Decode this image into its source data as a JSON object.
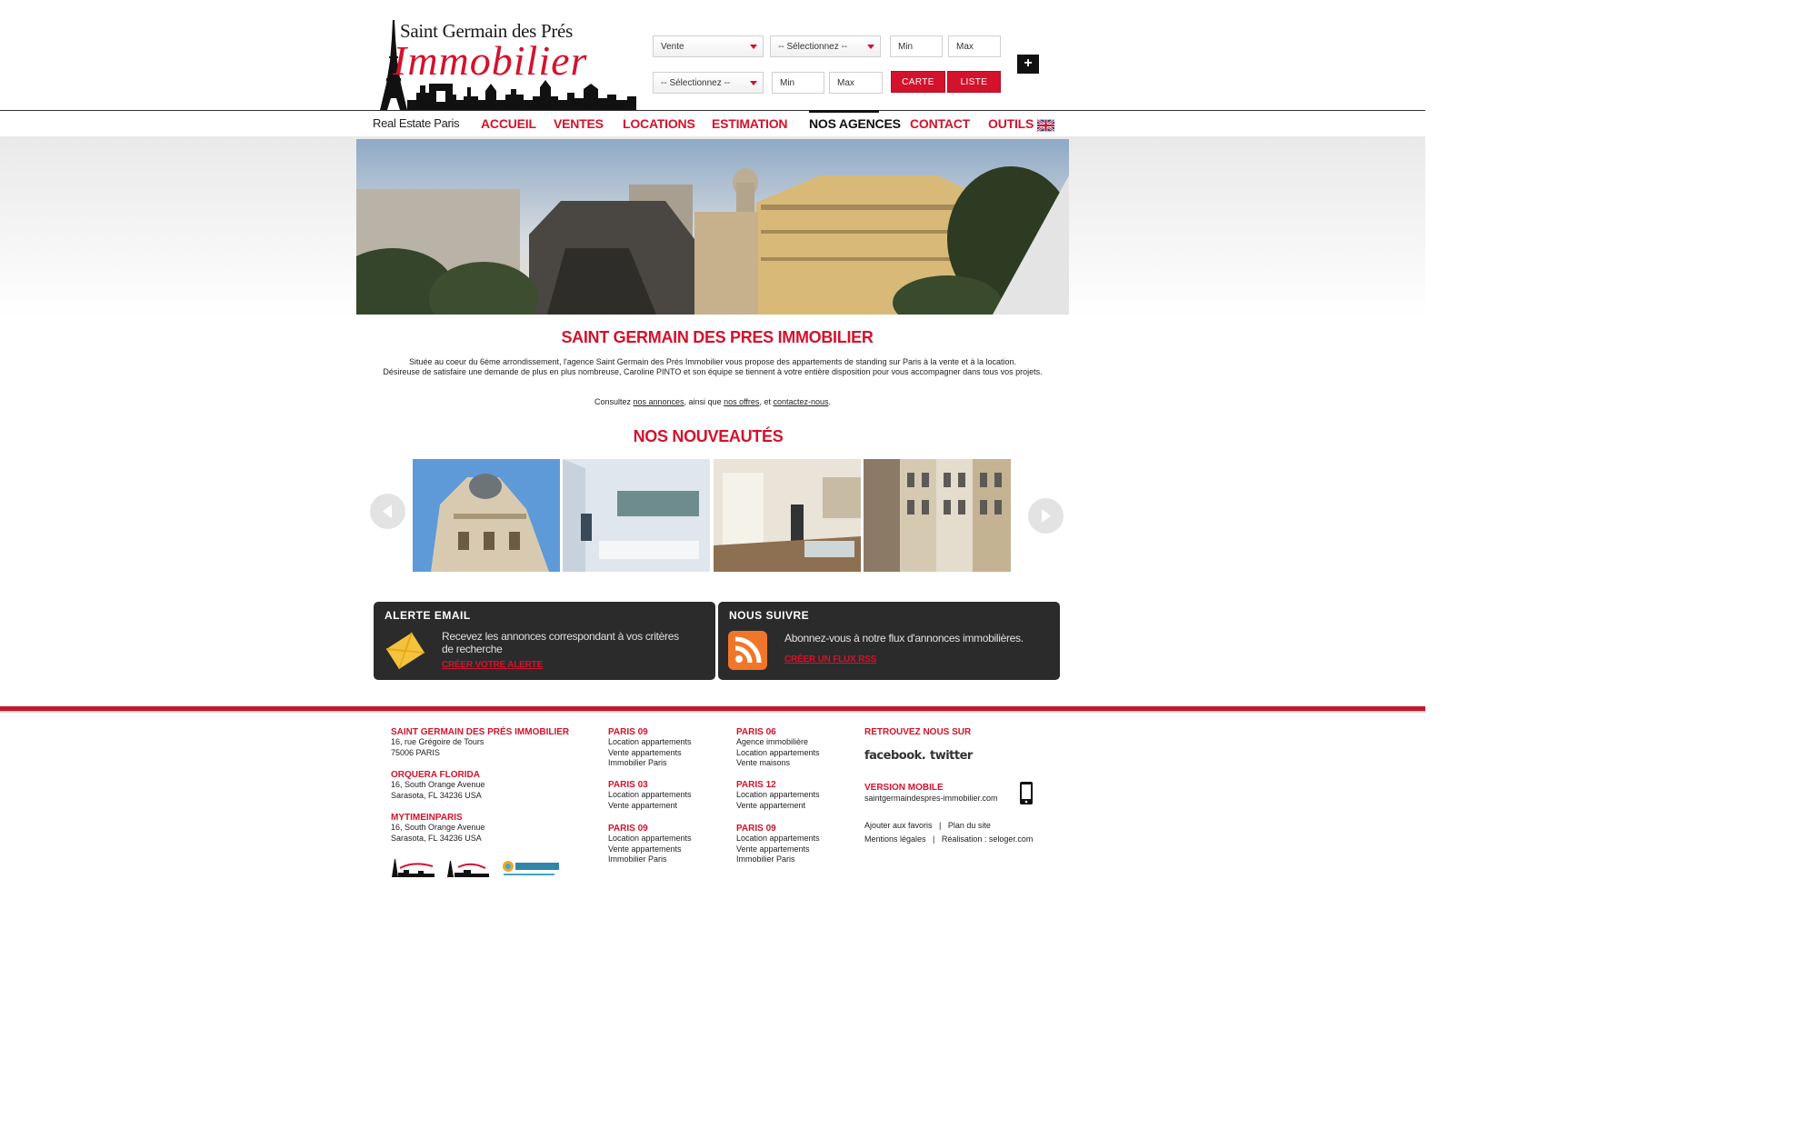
{
  "header": {
    "logo_title": "Saint Germain des Prés",
    "logo_script": "Immobilier",
    "search": {
      "transaction": "Vente",
      "type_select": "-- Sélectionnez --",
      "price_min": "Min",
      "price_max": "Max",
      "location_select": "-- Sélectionnez --",
      "surface_min": "Min",
      "surface_max": "Max",
      "map_button": "CARTE",
      "list_button": "LISTE",
      "more_button": "+"
    }
  },
  "nav": {
    "tagline": "Real Estate Paris",
    "items": [
      "ACCUEIL",
      "VENTES",
      "LOCATIONS",
      "ESTIMATION",
      "NOS AGENCES",
      "CONTACT",
      "OUTILS"
    ],
    "active": "NOS AGENCES"
  },
  "intro": {
    "title": "SAINT GERMAIN DES PRES IMMOBILIER",
    "line1": "Située au coeur du 6ème arrondissement, l'agence Saint Germain des Prés Immobilier vous propose des appartements de standing sur Paris  à la vente et à la location.",
    "line2": "Désireuse de satisfaire une demande de plus en plus nombreuse, Caroline PINTO et son équipe  se tiennent à votre entière disposition pour vous accompagner dans tous vos projets.",
    "consult_prefix": "Consultez ",
    "link_annonces": "nos annonces",
    "consult_mid1": ", ainsi que ",
    "link_offres": "nos offres",
    "consult_mid2": ", et ",
    "link_contact": "contactez-nous",
    "consult_suffix": "."
  },
  "news": {
    "title": "NOS NOUVEAUTÉS"
  },
  "cards": {
    "alert": {
      "title": "ALERTE EMAIL",
      "text": "Recevez les annonces correspondant à vos critères de recherche",
      "link": "CRÉER VOTRE ALERTE"
    },
    "follow": {
      "title": "NOUS SUIVRE",
      "text": "Abonnez-vous à notre flux d'annonces immobilières.",
      "link": "CRÉER UN FLUX RSS"
    }
  },
  "footer": {
    "agencies": [
      {
        "name": "SAINT GERMAIN DES PRÉS IMMOBILIER",
        "lines": [
          "16, rue Grégoire de Tours",
          "75006 PARIS"
        ]
      },
      {
        "name": "ORQUERA FLORIDA",
        "lines": [
          "16, South Orange Avenue",
          "Sarasota, FL 34236 USA"
        ]
      },
      {
        "name": "MYTIMEINPARIS",
        "lines": [
          "16, South Orange Avenue",
          "Sarasota, FL 34236 USA"
        ]
      }
    ],
    "partner_logos": [
      "Saint Germain des Prés Immobilier",
      "My Time in Paris",
      "ORQUERA"
    ],
    "col2": [
      {
        "head": "PARIS 09",
        "lines": [
          "Location appartements",
          "Vente appartements",
          "Immobilier Paris"
        ]
      },
      {
        "head": "PARIS 03",
        "lines": [
          "Location appartements",
          "Vente appartement"
        ]
      },
      {
        "head": "PARIS 09",
        "lines": [
          "Location appartements",
          "Vente appartements",
          "Immobilier Paris"
        ]
      }
    ],
    "col3": [
      {
        "head": "PARIS 06",
        "lines": [
          "Agence immobilière",
          "Location appartements",
          "Vente maisons"
        ]
      },
      {
        "head": "PARIS 12",
        "lines": [
          "Location appartements",
          "Vente appartement"
        ]
      },
      {
        "head": "PARIS 09",
        "lines": [
          "Location appartements",
          "Vente appartements",
          "Immobilier Paris"
        ]
      }
    ],
    "social_title": "RETROUVEZ NOUS SUR",
    "facebook": "facebook.",
    "twitter": "twitter",
    "mobile_title": "VERSION MOBILE",
    "mobile_url": "saintgermaindespres-immobilier.com",
    "links_row1": "Ajouter aux favoris   |   Plan du site",
    "links_row2": "Mentions légales   |   Réalisation : seloger.com"
  },
  "colors": {
    "accent": "#d4122c",
    "dark": "#2b2b2b"
  }
}
